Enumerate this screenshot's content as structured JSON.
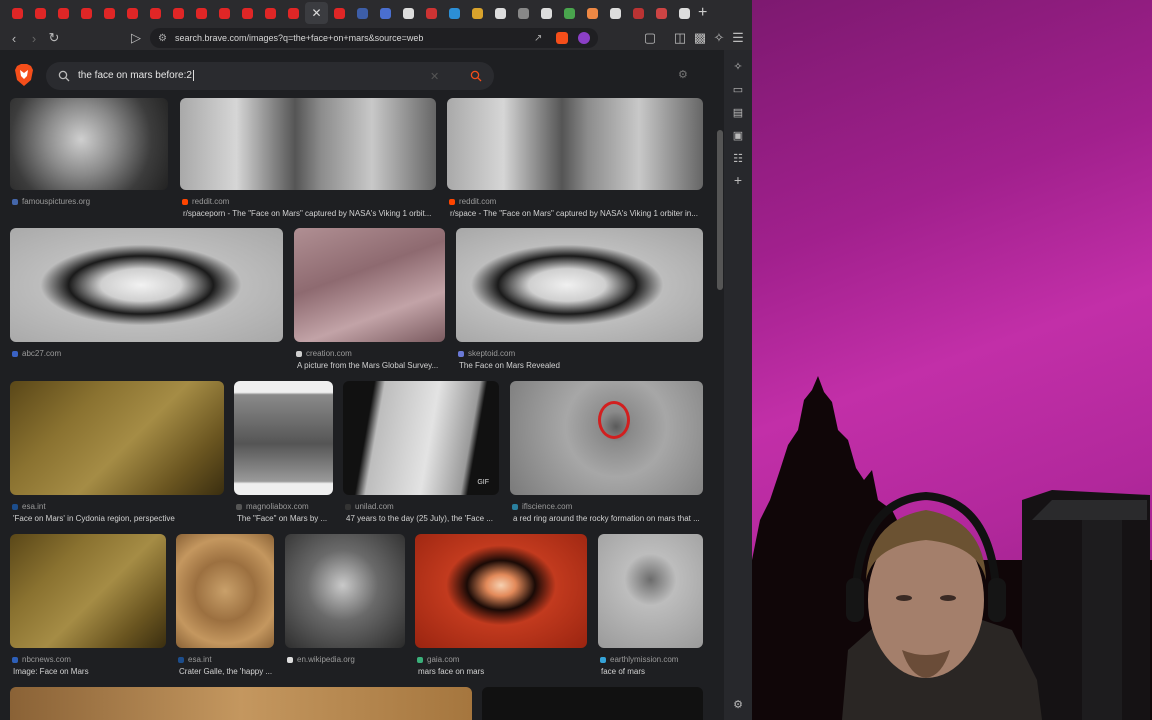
{
  "browser": {
    "tab_favicons": [
      {
        "name": "youtube-tab",
        "color": "#e02626"
      },
      {
        "name": "youtube-tab",
        "color": "#e02626"
      },
      {
        "name": "youtube-tab",
        "color": "#e02626"
      },
      {
        "name": "youtube-tab",
        "color": "#e02626"
      },
      {
        "name": "youtube-tab",
        "color": "#e02626"
      },
      {
        "name": "youtube-tab",
        "color": "#e02626"
      },
      {
        "name": "youtube-tab",
        "color": "#e02626"
      },
      {
        "name": "youtube-tab",
        "color": "#e02626"
      },
      {
        "name": "youtube-tab",
        "color": "#e02626"
      },
      {
        "name": "youtube-tab",
        "color": "#e02626"
      },
      {
        "name": "youtube-tab",
        "color": "#e02626"
      },
      {
        "name": "youtube-tab",
        "color": "#e02626"
      },
      {
        "name": "youtube-tab",
        "color": "#e02626"
      },
      {
        "name": "active-tab-close",
        "color": "#dddddd"
      },
      {
        "name": "youtube-tab",
        "color": "#e02626"
      },
      {
        "name": "wiki-tab",
        "color": "#3d5ea8"
      },
      {
        "name": "site-tab",
        "color": "#4a6fd0"
      },
      {
        "name": "wiki-tab",
        "color": "#dddddd"
      },
      {
        "name": "site-tab",
        "color": "#c33"
      },
      {
        "name": "site-tab",
        "color": "#2c8fd6"
      },
      {
        "name": "site-tab",
        "color": "#d9a32c"
      },
      {
        "name": "wiki-tab",
        "color": "#dddddd"
      },
      {
        "name": "site-tab",
        "color": "#888"
      },
      {
        "name": "wiki-tab",
        "color": "#dddddd"
      },
      {
        "name": "site-tab",
        "color": "#49a54d"
      },
      {
        "name": "site-tab",
        "color": "#e84"
      },
      {
        "name": "wiki-tab",
        "color": "#dddddd"
      },
      {
        "name": "site-tab",
        "color": "#b33"
      },
      {
        "name": "site-tab",
        "color": "#c44"
      },
      {
        "name": "wiki-tab",
        "color": "#dddddd"
      }
    ],
    "new_tab_label": "+",
    "url": "search.brave.com/images?q=the+face+on+mars&source=web"
  },
  "search": {
    "query": "the face on mars before:2"
  },
  "results": [
    {
      "source": "famouspictures.org",
      "title": "",
      "dot": "#4466aa"
    },
    {
      "source": "reddit.com",
      "title": "r/spaceporn - The \"Face on Mars\" captured by NASA's Viking 1 orbit...",
      "dot": "#ff4500"
    },
    {
      "source": "reddit.com",
      "title": "r/space - The \"Face on Mars\" captured by NASA's Viking 1 orbiter in...",
      "dot": "#ff4500"
    },
    {
      "source": "abc27.com",
      "title": "",
      "dot": "#3a62c4"
    },
    {
      "source": "creation.com",
      "title": "A picture from the Mars Global Survey...",
      "dot": "#cfcfcf"
    },
    {
      "source": "skeptoid.com",
      "title": "The Face on Mars Revealed",
      "dot": "#6a79d6"
    },
    {
      "source": "esa.int",
      "title": "'Face on Mars' in Cydonia region, perspective",
      "dot": "#1c4d8c"
    },
    {
      "source": "magnoliabox.com",
      "title": "The \"Face\" on Mars by ...",
      "dot": "#555"
    },
    {
      "source": "unilad.com",
      "title": "47 years to the day (25 July), the 'Face ...",
      "dot": "#333"
    },
    {
      "source": "iflscience.com",
      "title": "a red ring around the rocky formation on mars that ...",
      "dot": "#2a7f9e"
    },
    {
      "source": "nbcnews.com",
      "title": "Image: Face on Mars",
      "dot": "#2d5fb8"
    },
    {
      "source": "esa.int",
      "title": "Crater Galle, the 'happy ...",
      "dot": "#1c4d8c"
    },
    {
      "source": "en.wikipedia.org",
      "title": "",
      "dot": "#dddddd"
    },
    {
      "source": "gaia.com",
      "title": "mars face on mars",
      "dot": "#3ab07a"
    },
    {
      "source": "earthlymission.com",
      "title": "face of mars",
      "dot": "#35a3d8"
    }
  ],
  "gif_badge": "GIF"
}
